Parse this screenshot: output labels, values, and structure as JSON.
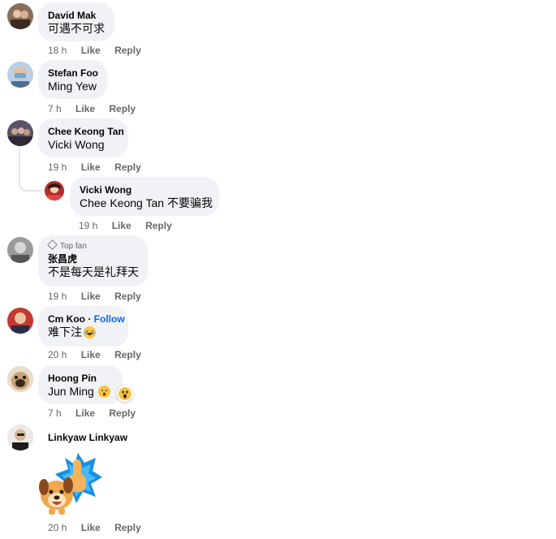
{
  "actions": {
    "like": "Like",
    "reply": "Reply"
  },
  "comments": [
    {
      "author": "David Mak",
      "text": "可遇不可求",
      "time": "18 h"
    },
    {
      "author": "Stefan Foo",
      "text": "Ming Yew",
      "time": "7 h"
    },
    {
      "author": "Chee Keong Tan",
      "text": "Vicki Wong",
      "time": "19 h"
    },
    {
      "author": "Vicki Wong",
      "text": "Chee Keong Tan 不要骗我",
      "time": "19 h"
    },
    {
      "badge": "Top fan",
      "author": "张昌虎",
      "text": "不是每天是礼拜天",
      "time": "19 h"
    },
    {
      "author": "Cm Koo",
      "follow": "Follow",
      "text": "难下注",
      "time": "20 h"
    },
    {
      "author": "Hoong Pin",
      "text": "Jun Ming",
      "time": "7 h"
    },
    {
      "author": "Linkyaw Linkyaw",
      "time": "20 h"
    }
  ],
  "colors": {
    "bubble": "#f0f2f5",
    "link": "#0866ff",
    "meta": "#65676b"
  }
}
